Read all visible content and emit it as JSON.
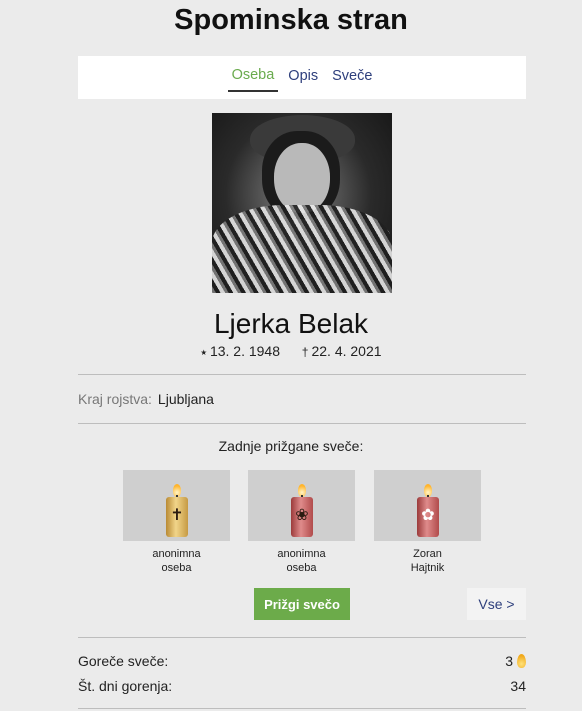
{
  "page": {
    "title": "Spominska stran"
  },
  "tabs": [
    {
      "label": "Oseba",
      "active": true
    },
    {
      "label": "Opis",
      "active": false
    },
    {
      "label": "Sveče",
      "active": false
    }
  ],
  "person": {
    "name": "Ljerka Belak",
    "birth_symbol": "⭑",
    "birth_date": "13. 2. 1948",
    "death_symbol": "†",
    "death_date": "22. 4. 2021"
  },
  "birthplace": {
    "label": "Kraj rojstva:",
    "value": "Ljubljana"
  },
  "candles": {
    "title": "Zadnje prižgane sveče:",
    "items": [
      {
        "line1": "anonimna",
        "line2": "oseba",
        "color": "gold",
        "symbol": "✝"
      },
      {
        "line1": "anonimna",
        "line2": "oseba",
        "color": "red",
        "symbol": "❀"
      },
      {
        "line1": "Zoran",
        "line2": "Hajtnik",
        "color": "red",
        "symbol": "✿"
      }
    ],
    "light_button": "Prižgi svečo",
    "all_button": "Vse >"
  },
  "stats": {
    "burning_label": "Goreče sveče:",
    "burning_value": "3",
    "days_label": "Št. dni gorenja:",
    "days_value": "34"
  },
  "colors": {
    "accent_green": "#6cab4a",
    "link_blue": "#2e3f7c",
    "background": "#ebebeb"
  },
  "icons": {
    "flame": "flame-icon",
    "photo": "portrait-photo"
  }
}
